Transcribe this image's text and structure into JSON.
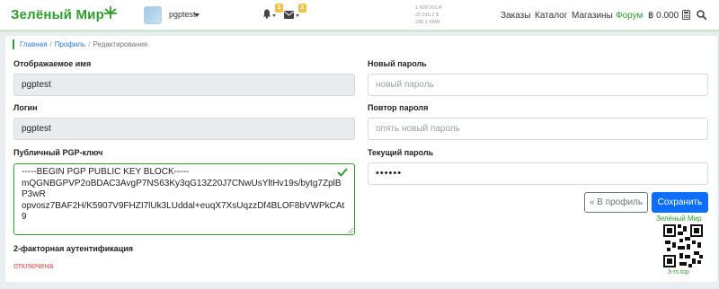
{
  "header": {
    "brand": "Зелёный Мир",
    "user": {
      "name": "pgptest"
    },
    "notifications": {
      "bell_badge": "1",
      "mail_badge": "1"
    },
    "rates": [
      "1 609 201 ₽",
      "20 016.2 $",
      "226.1 XMR"
    ],
    "nav": [
      "Заказы",
      "Каталог",
      "Магазины",
      "Форум"
    ],
    "balance": "฿ 0.000",
    "colors": {
      "brand": "#2e9e2e",
      "badge": "#f0c24b"
    }
  },
  "breadcrumb": [
    "Главная",
    "Профиль",
    "Редактирование"
  ],
  "form": {
    "display_name": {
      "label": "Отображаемое имя",
      "value": "pgptest"
    },
    "login": {
      "label": "Логин",
      "value": "pgptest"
    },
    "pgp": {
      "label": "Публичный PGP-ключ",
      "lines": [
        "-----BEGIN PGP PUBLIC KEY BLOCK-----",
        "mQGNBGPVP2oBDAC3AvgP7NS63Ky3qG13Z20J7CNwUsYltHv19s/bytg7ZplB",
        "P3wR",
        "opvosz7BAF2H/K5907V9FHZI7lUk3LUddal+euqX7XsUqzzDf4BLOF8bVWPkCAt",
        "9"
      ]
    },
    "twofa": {
      "label": "2-факторная аутентификация",
      "status": "отключена"
    },
    "new_password": {
      "label": "Новый пароль",
      "placeholder": "новый пароль"
    },
    "repeat_password": {
      "label": "Повтор пароля",
      "placeholder": "опять новый пароль"
    },
    "current_password": {
      "label": "Текущий пароль",
      "value": "••••••"
    },
    "buttons": {
      "back": "« В профиль",
      "save": "Сохранить"
    }
  },
  "qr": {
    "title": "Зелёный Мир",
    "url": "3-m.top"
  }
}
